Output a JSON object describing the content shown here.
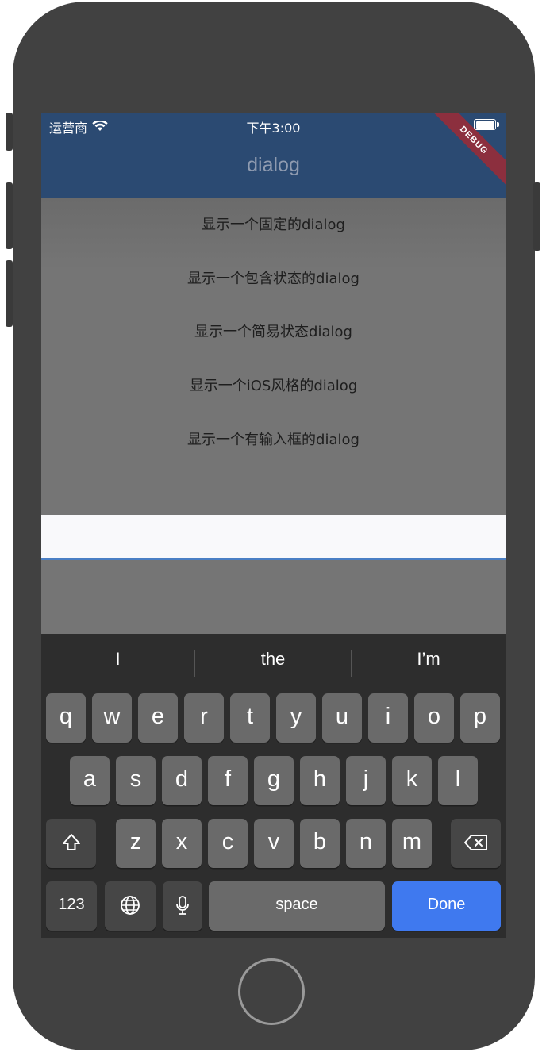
{
  "status_bar": {
    "carrier": "运营商",
    "time": "下午3:00"
  },
  "app_bar": {
    "title": "dialog",
    "debug_banner": "DEBUG"
  },
  "menu": {
    "items": [
      "显示一个固定的dialog",
      "显示一个包含状态的dialog",
      "显示一个简易状态dialog",
      "显示一个iOS风格的dialog",
      "显示一个有输入框的dialog"
    ]
  },
  "text_field": {
    "value": ""
  },
  "keyboard": {
    "suggestions": [
      "I",
      "the",
      "I’m"
    ],
    "row1": [
      "q",
      "w",
      "e",
      "r",
      "t",
      "y",
      "u",
      "i",
      "o",
      "p"
    ],
    "row2": [
      "a",
      "s",
      "d",
      "f",
      "g",
      "h",
      "j",
      "k",
      "l"
    ],
    "row3": [
      "z",
      "x",
      "c",
      "v",
      "b",
      "n",
      "m"
    ],
    "numbers_key": "123",
    "space_key": "space",
    "done_key": "Done",
    "icons": [
      "shift-icon",
      "delete-icon",
      "globe-icon",
      "mic-icon"
    ]
  },
  "colors": {
    "app_bar": "#2b4a72",
    "done_key": "#3f79ef",
    "debug_banner": "#8c2f3e"
  }
}
